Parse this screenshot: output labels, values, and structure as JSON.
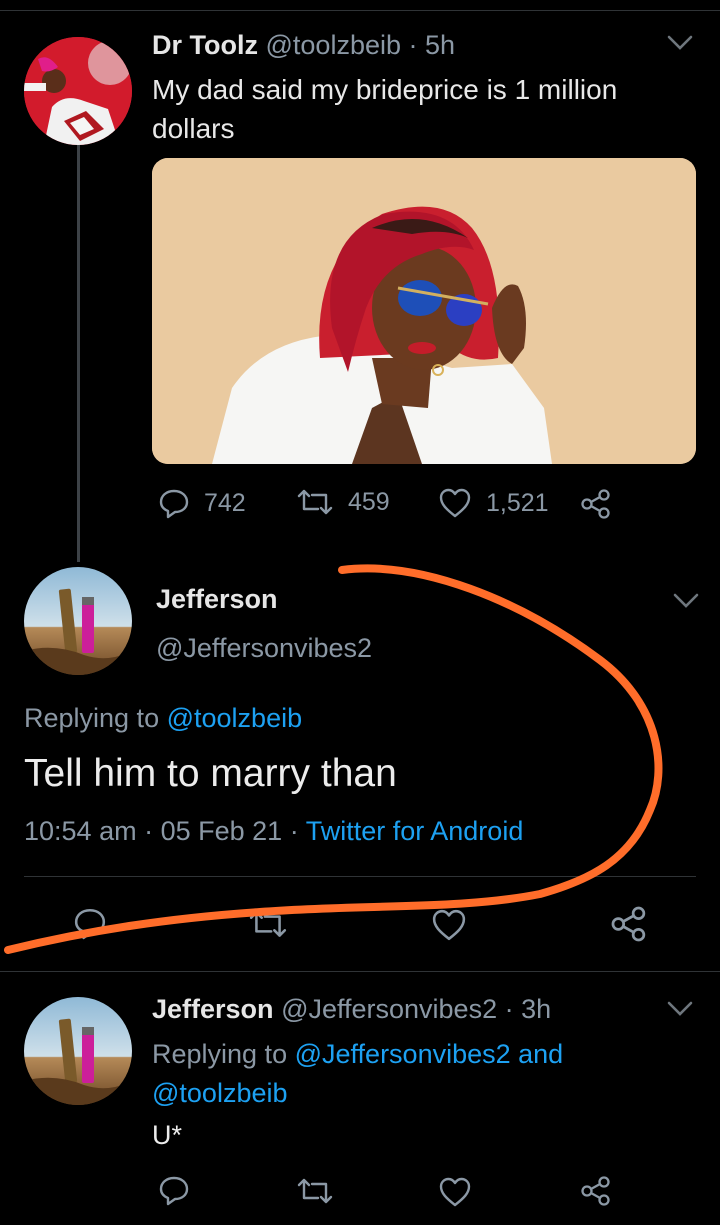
{
  "tweet1": {
    "name": "Dr Toolz",
    "handle": "@toolzbeib",
    "dot": "·",
    "time": "5h",
    "text": "My dad said my brideprice is 1 million dollars",
    "replies": "742",
    "retweets": "459",
    "likes": "1,521"
  },
  "tweet2": {
    "name": "Jefferson",
    "handle": "@Jeffersonvibes2",
    "replying_prefix": "Replying to",
    "replying_handle": "@toolzbeib",
    "text": "Tell him to marry than",
    "time": "10:54 am",
    "dot1": "·",
    "date": "05 Feb 21",
    "dot2": "·",
    "source": "Twitter for Android"
  },
  "tweet3": {
    "name": "Jefferson",
    "handle": "@Jeffersonvibes2",
    "dot": "·",
    "time": "3h",
    "replying_prefix": "Replying to",
    "replying_handles": "@Jeffersonvibes2 and",
    "replying_handles2": "@toolzbeib",
    "text": "U*"
  },
  "icons": {
    "reply": "reply-icon",
    "retweet": "retweet-icon",
    "like": "heart-icon",
    "share": "share-icon",
    "caret": "chevron-down-icon"
  },
  "colors": {
    "background": "#000000",
    "text": "#d9d9d9",
    "muted": "#8b98a5",
    "link": "#1da1f2",
    "annotation": "#ff6d2a",
    "media_bg": "#eacaa0"
  }
}
